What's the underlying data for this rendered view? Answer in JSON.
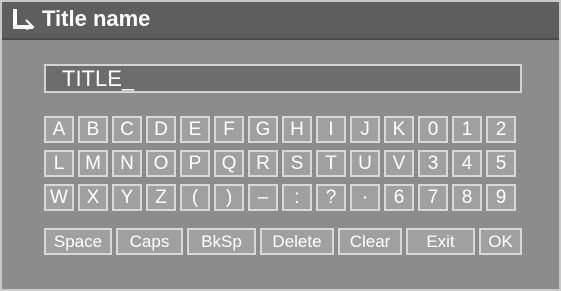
{
  "window": {
    "title": "Title name",
    "title_icon": "corner-arrow-icon"
  },
  "entry": {
    "value": "TITLE_"
  },
  "keyboard": {
    "rows": [
      [
        "A",
        "B",
        "C",
        "D",
        "E",
        "F",
        "G",
        "H",
        "I",
        "J",
        "K",
        "0",
        "1",
        "2"
      ],
      [
        "L",
        "M",
        "N",
        "O",
        "P",
        "Q",
        "R",
        "S",
        "T",
        "U",
        "V",
        "3",
        "4",
        "5"
      ],
      [
        "W",
        "X",
        "Y",
        "Z",
        "(",
        ")",
        "–",
        ":",
        "?",
        "·",
        "6",
        "7",
        "8",
        "9"
      ]
    ],
    "function_keys": [
      "Space",
      "Caps",
      "BkSp",
      "Delete",
      "Clear",
      "Exit",
      "OK"
    ]
  },
  "colors": {
    "panel": "#8c8c8c",
    "titlebar": "#5e5e5e",
    "key_fill": "#a0a0a0",
    "key_border": "#d8d8d8",
    "text": "#ffffff"
  }
}
